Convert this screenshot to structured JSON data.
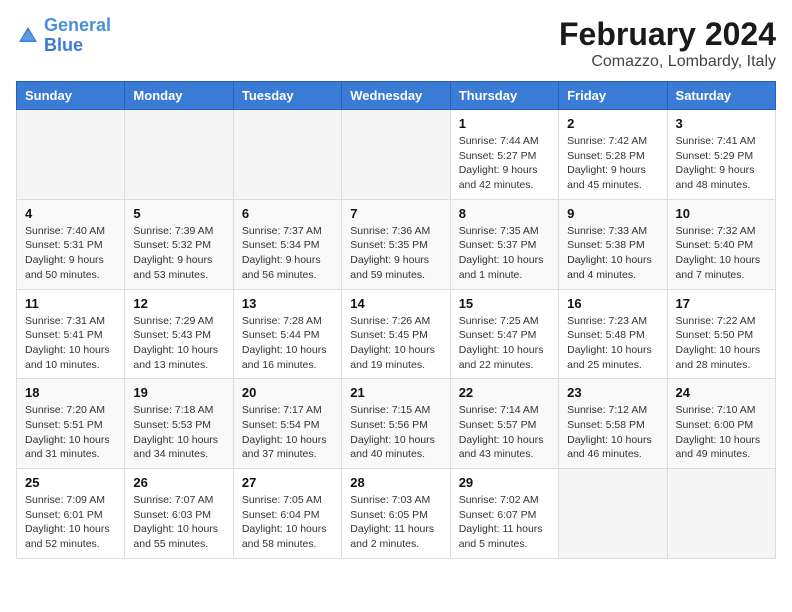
{
  "header": {
    "logo_text_general": "General",
    "logo_text_blue": "Blue",
    "month_title": "February 2024",
    "location": "Comazzo, Lombardy, Italy"
  },
  "calendar": {
    "days_of_week": [
      "Sunday",
      "Monday",
      "Tuesday",
      "Wednesday",
      "Thursday",
      "Friday",
      "Saturday"
    ],
    "weeks": [
      [
        {
          "day": "",
          "info": ""
        },
        {
          "day": "",
          "info": ""
        },
        {
          "day": "",
          "info": ""
        },
        {
          "day": "",
          "info": ""
        },
        {
          "day": "1",
          "info": "Sunrise: 7:44 AM\nSunset: 5:27 PM\nDaylight: 9 hours\nand 42 minutes."
        },
        {
          "day": "2",
          "info": "Sunrise: 7:42 AM\nSunset: 5:28 PM\nDaylight: 9 hours\nand 45 minutes."
        },
        {
          "day": "3",
          "info": "Sunrise: 7:41 AM\nSunset: 5:29 PM\nDaylight: 9 hours\nand 48 minutes."
        }
      ],
      [
        {
          "day": "4",
          "info": "Sunrise: 7:40 AM\nSunset: 5:31 PM\nDaylight: 9 hours\nand 50 minutes."
        },
        {
          "day": "5",
          "info": "Sunrise: 7:39 AM\nSunset: 5:32 PM\nDaylight: 9 hours\nand 53 minutes."
        },
        {
          "day": "6",
          "info": "Sunrise: 7:37 AM\nSunset: 5:34 PM\nDaylight: 9 hours\nand 56 minutes."
        },
        {
          "day": "7",
          "info": "Sunrise: 7:36 AM\nSunset: 5:35 PM\nDaylight: 9 hours\nand 59 minutes."
        },
        {
          "day": "8",
          "info": "Sunrise: 7:35 AM\nSunset: 5:37 PM\nDaylight: 10 hours\nand 1 minute."
        },
        {
          "day": "9",
          "info": "Sunrise: 7:33 AM\nSunset: 5:38 PM\nDaylight: 10 hours\nand 4 minutes."
        },
        {
          "day": "10",
          "info": "Sunrise: 7:32 AM\nSunset: 5:40 PM\nDaylight: 10 hours\nand 7 minutes."
        }
      ],
      [
        {
          "day": "11",
          "info": "Sunrise: 7:31 AM\nSunset: 5:41 PM\nDaylight: 10 hours\nand 10 minutes."
        },
        {
          "day": "12",
          "info": "Sunrise: 7:29 AM\nSunset: 5:43 PM\nDaylight: 10 hours\nand 13 minutes."
        },
        {
          "day": "13",
          "info": "Sunrise: 7:28 AM\nSunset: 5:44 PM\nDaylight: 10 hours\nand 16 minutes."
        },
        {
          "day": "14",
          "info": "Sunrise: 7:26 AM\nSunset: 5:45 PM\nDaylight: 10 hours\nand 19 minutes."
        },
        {
          "day": "15",
          "info": "Sunrise: 7:25 AM\nSunset: 5:47 PM\nDaylight: 10 hours\nand 22 minutes."
        },
        {
          "day": "16",
          "info": "Sunrise: 7:23 AM\nSunset: 5:48 PM\nDaylight: 10 hours\nand 25 minutes."
        },
        {
          "day": "17",
          "info": "Sunrise: 7:22 AM\nSunset: 5:50 PM\nDaylight: 10 hours\nand 28 minutes."
        }
      ],
      [
        {
          "day": "18",
          "info": "Sunrise: 7:20 AM\nSunset: 5:51 PM\nDaylight: 10 hours\nand 31 minutes."
        },
        {
          "day": "19",
          "info": "Sunrise: 7:18 AM\nSunset: 5:53 PM\nDaylight: 10 hours\nand 34 minutes."
        },
        {
          "day": "20",
          "info": "Sunrise: 7:17 AM\nSunset: 5:54 PM\nDaylight: 10 hours\nand 37 minutes."
        },
        {
          "day": "21",
          "info": "Sunrise: 7:15 AM\nSunset: 5:56 PM\nDaylight: 10 hours\nand 40 minutes."
        },
        {
          "day": "22",
          "info": "Sunrise: 7:14 AM\nSunset: 5:57 PM\nDaylight: 10 hours\nand 43 minutes."
        },
        {
          "day": "23",
          "info": "Sunrise: 7:12 AM\nSunset: 5:58 PM\nDaylight: 10 hours\nand 46 minutes."
        },
        {
          "day": "24",
          "info": "Sunrise: 7:10 AM\nSunset: 6:00 PM\nDaylight: 10 hours\nand 49 minutes."
        }
      ],
      [
        {
          "day": "25",
          "info": "Sunrise: 7:09 AM\nSunset: 6:01 PM\nDaylight: 10 hours\nand 52 minutes."
        },
        {
          "day": "26",
          "info": "Sunrise: 7:07 AM\nSunset: 6:03 PM\nDaylight: 10 hours\nand 55 minutes."
        },
        {
          "day": "27",
          "info": "Sunrise: 7:05 AM\nSunset: 6:04 PM\nDaylight: 10 hours\nand 58 minutes."
        },
        {
          "day": "28",
          "info": "Sunrise: 7:03 AM\nSunset: 6:05 PM\nDaylight: 11 hours\nand 2 minutes."
        },
        {
          "day": "29",
          "info": "Sunrise: 7:02 AM\nSunset: 6:07 PM\nDaylight: 11 hours\nand 5 minutes."
        },
        {
          "day": "",
          "info": ""
        },
        {
          "day": "",
          "info": ""
        }
      ]
    ]
  }
}
